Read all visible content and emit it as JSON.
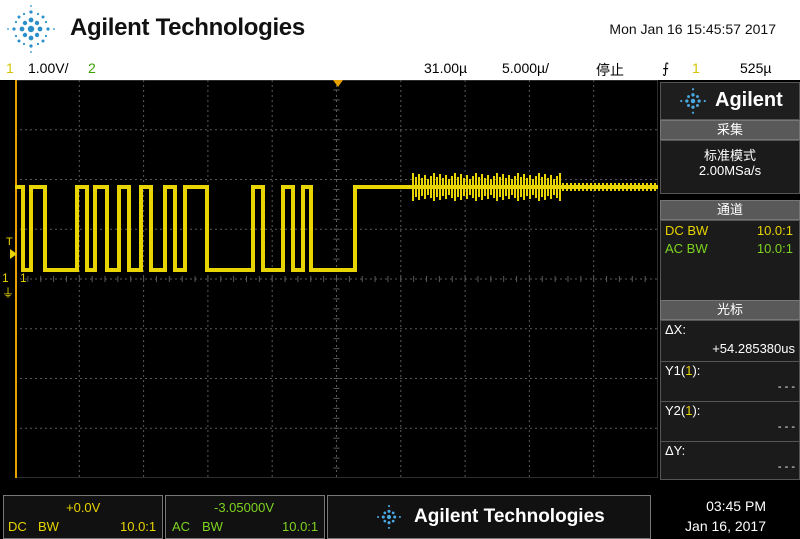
{
  "header": {
    "brand": "Agilent Technologies",
    "datetime": "Mon Jan 16 15:45:57 2017"
  },
  "status_bar": {
    "ch1_label": "1",
    "ch1_scale": "1.00V/",
    "ch2_label": "2",
    "time_offset": "31.00µ",
    "time_scale": "5.000µ/",
    "run_state": "停止",
    "trigger_symbol": "⨍",
    "trigger_source": "1",
    "trigger_level": "525µ"
  },
  "markers": {
    "trigger_T": "T",
    "ch1_marker": "1"
  },
  "side_panel": {
    "logo": "Agilent",
    "acquire": {
      "title": "采集",
      "mode": "标准模式",
      "rate": "2.00MSa/s"
    },
    "channels": {
      "title": "通道",
      "row1_left": "DC BW",
      "row1_right": "10.0:1",
      "row2_left": "AC BW",
      "row2_right": "10.0:1"
    },
    "cursors": {
      "title": "光标",
      "dx_label": "ΔX:",
      "dx_value": "+54.285380us",
      "y1_label": "Y1(1):",
      "y1_value": "- - -",
      "y2_label": "Y2(1):",
      "y2_value": "- - -",
      "dy_label": "ΔY:",
      "dy_value": "- - -"
    }
  },
  "footer": {
    "ch1_offset": "+0.0V",
    "ch1_coupling": "DC",
    "ch1_bw": "BW",
    "ch1_probe": "10.0:1",
    "ch2_offset": "-3.05000V",
    "ch2_coupling": "AC",
    "ch2_bw": "BW",
    "ch2_probe": "10.0:1",
    "brand": "Agilent Technologies",
    "time": "03:45 PM",
    "date": "Jan 16, 2017"
  },
  "colors": {
    "ch1": "#e8d400",
    "ch2": "#7ed321",
    "grid": "#5a5a5a"
  }
}
